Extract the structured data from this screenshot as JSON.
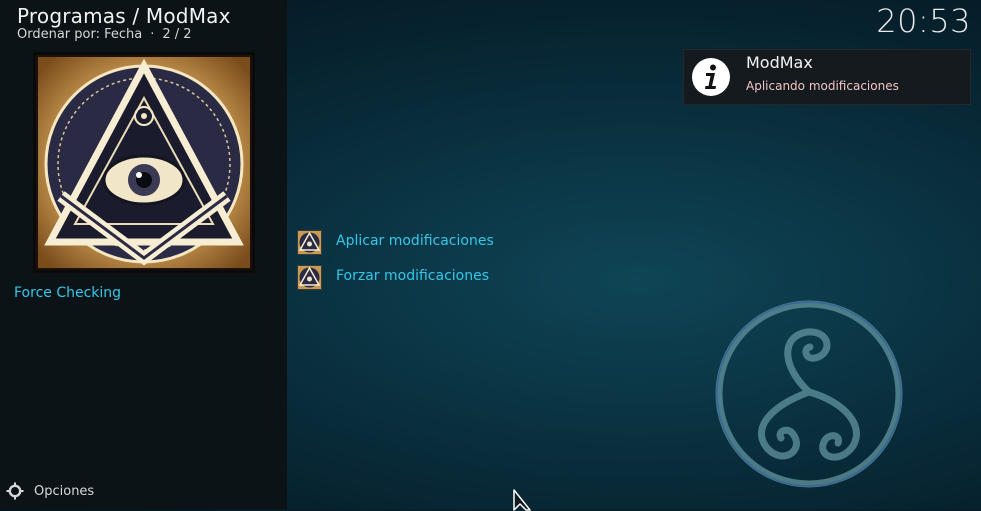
{
  "header": {
    "title": "Programas / ModMax",
    "sort_label": "Ordenar por: Fecha",
    "separator": "·",
    "count": "2 / 2"
  },
  "clock": "20:53",
  "sidebar": {
    "selected_item_label": "Force Checking",
    "options_label": "Opciones"
  },
  "notification": {
    "title": "ModMax",
    "message": "Aplicando modificaciones",
    "icon": "info-icon"
  },
  "list": {
    "items": [
      {
        "label": "Aplicar modificaciones",
        "icon": "masonic-eye-icon"
      },
      {
        "label": "Forzar modificaciones",
        "icon": "masonic-eye-icon"
      }
    ]
  },
  "colors": {
    "accent": "#35c7ea",
    "notification_message": "#f2c4c4",
    "background": "#0a3342"
  }
}
